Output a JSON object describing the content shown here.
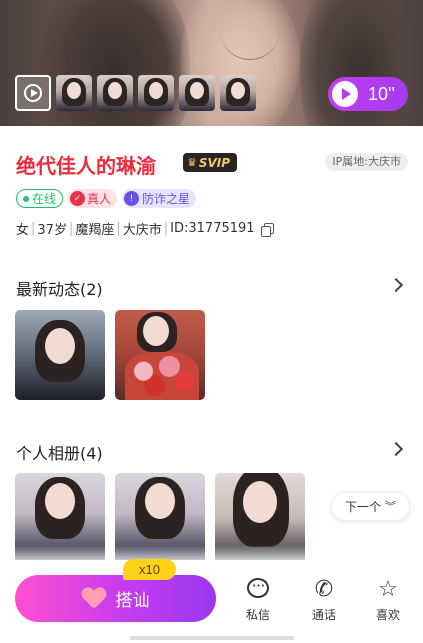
{
  "hero": {
    "video_duration": "10''"
  },
  "profile": {
    "name": "绝代佳人的琳渝",
    "vip_badge": "SVIP",
    "ip_location": "IP属地:大庆市",
    "tags": {
      "online": "在线",
      "verified": "真人",
      "anti_fraud": "防诈之星"
    },
    "info": {
      "gender": "女",
      "age": "37岁",
      "zodiac": "魔羯座",
      "city": "大庆市",
      "id": "ID:31775191"
    }
  },
  "sections": {
    "moments_title": "最新动态(2)",
    "album_title": "个人相册(4)",
    "next_label": "下一个"
  },
  "bottom_bar": {
    "chat_label": "搭讪",
    "chat_multiplier": "x10",
    "message_label": "私信",
    "call_label": "通话",
    "like_label": "喜欢"
  },
  "colors": {
    "name": "#ee2b3d",
    "accent_gradient_start": "#ff4fd0",
    "accent_gradient_end": "#9b38ef",
    "online": "#20c36a"
  }
}
